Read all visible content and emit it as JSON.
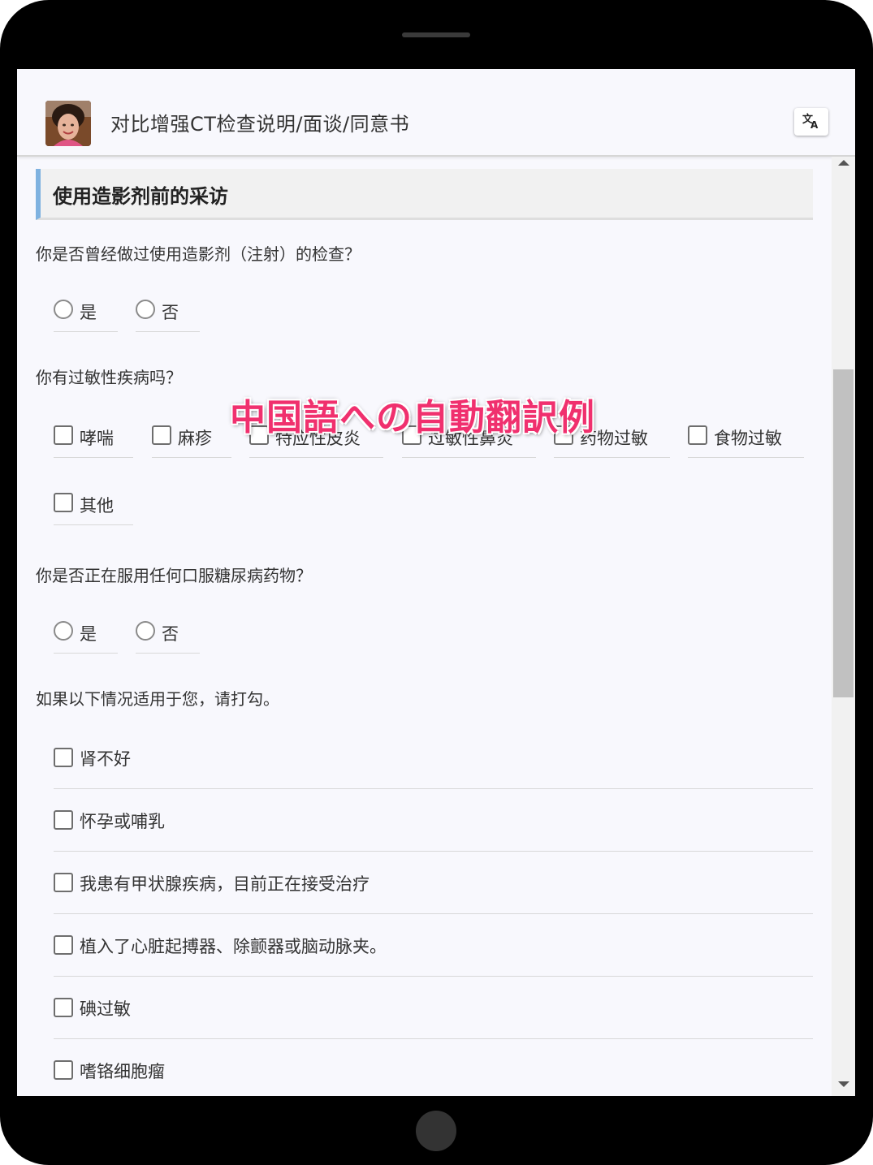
{
  "header": {
    "title": "对比增强CT检查说明/面谈/同意书",
    "translate_icon": "translate-icon"
  },
  "section": {
    "title": "使用造影剂前的采访"
  },
  "overlay_text": "中国語への自動翻訳例",
  "questions": [
    {
      "text": "你是否曾经做过使用造影剂（注射）的检查？",
      "type": "radio",
      "options": [
        "是",
        "否"
      ]
    },
    {
      "text": "你有过敏性疾病吗？",
      "type": "checkbox",
      "options": [
        "哮喘",
        "麻疹",
        "特应性皮炎",
        "过敏性鼻炎",
        "药物过敏",
        "食物过敏",
        "其他"
      ]
    },
    {
      "text": "你是否正在服用任何口服糖尿病药物？",
      "type": "radio",
      "options": [
        "是",
        "否"
      ]
    },
    {
      "text": "如果以下情况适用于您，请打勾。",
      "type": "checkbox-list",
      "options": [
        "肾不好",
        "怀孕或哺乳",
        "我患有甲状腺疾病，目前正在接受治疗",
        "植入了心脏起搏器、除颤器或脑动脉夹。",
        "碘过敏",
        "嗜铬细胞瘤"
      ]
    }
  ]
}
